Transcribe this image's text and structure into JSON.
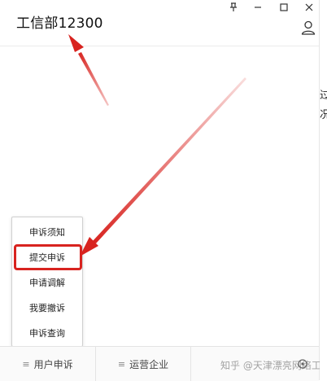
{
  "window": {
    "controls": {
      "pin": "⊥",
      "minimize": "—",
      "maximize": "□",
      "close": "✕"
    }
  },
  "header": {
    "title": "工信部12300"
  },
  "popup_menu": {
    "items": [
      {
        "label": "申诉须知"
      },
      {
        "label": "提交申诉"
      },
      {
        "label": "申请调解"
      },
      {
        "label": "我要撤诉"
      },
      {
        "label": "申诉查询"
      }
    ],
    "highlighted_index": 1
  },
  "tabbar": {
    "tabs": [
      {
        "label": "用户申诉",
        "icon": "≡"
      },
      {
        "label": "运营企业",
        "icon": "≡"
      },
      {
        "label": "",
        "icon": ""
      }
    ]
  },
  "watermark": "知乎 @天津漂亮网络工作室",
  "right_edge": {
    "fragments": [
      "过",
      "况"
    ]
  },
  "colors": {
    "accent_red": "#d8231f",
    "link_blue": "#3a72d6"
  }
}
